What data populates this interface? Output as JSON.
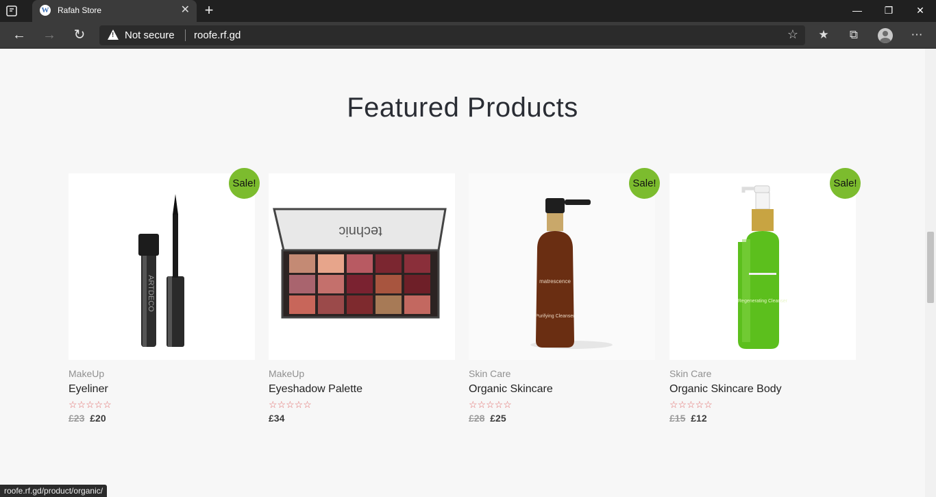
{
  "browser": {
    "tab_title": "Rafah Store",
    "tab_icon": "wordpress-icon",
    "tab_close": "✕",
    "new_tab": "+",
    "security_label": "Not secure",
    "url": "roofe.rf.gd",
    "window_controls": {
      "minimize": "—",
      "restore": "❐",
      "close": "✕"
    }
  },
  "page": {
    "section_title": "Featured Products",
    "products": [
      {
        "category": "MakeUp",
        "name": "Eyeliner",
        "sale_badge": "Sale!",
        "stars": "☆☆☆☆☆",
        "old_price": "£23",
        "price": "£20"
      },
      {
        "category": "MakeUp",
        "name": "Eyeshadow Palette",
        "sale_badge": "",
        "stars": "☆☆☆☆☆",
        "old_price": "",
        "price": "£34",
        "palette_brand": "technic"
      },
      {
        "category": "Skin Care",
        "name": "Organic Skincare",
        "sale_badge": "Sale!",
        "stars": "☆☆☆☆☆",
        "old_price": "£28",
        "price": "£25",
        "bottle_brand": "matrescence",
        "bottle_text": "Purifying Cleanser"
      },
      {
        "category": "Skin Care",
        "name": "Organic Skincare Body",
        "sale_badge": "Sale!",
        "stars": "☆☆☆☆☆",
        "old_price": "£15",
        "price": "£12",
        "bottle_text": "Regenerating Cleanser"
      }
    ]
  },
  "status_url": "roofe.rf.gd/product/organic/",
  "colors": {
    "sale_badge": "#7cbc2e",
    "stars": "#e06a6a",
    "browser_chrome": "#202020"
  }
}
